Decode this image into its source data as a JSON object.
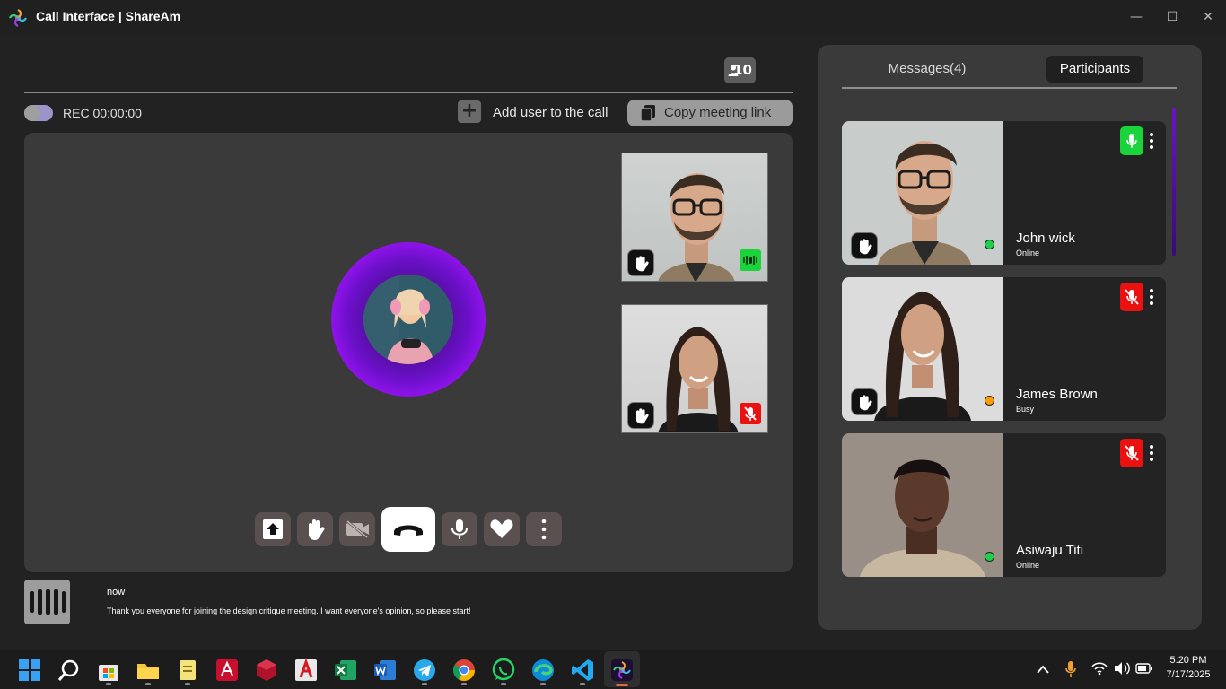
{
  "window": {
    "title": "Call Interface | ShareAm",
    "minimize_glyph": "—",
    "maximize_glyph": "☐",
    "close_glyph": "✕"
  },
  "call": {
    "participant_count": "10",
    "recording_label": "REC 00:00:00",
    "recording_on": false,
    "add_user_glyph": "+",
    "add_user_label": "Add user to the call",
    "copy_link_label": "Copy meeting link"
  },
  "stage": {
    "tiles": [
      {
        "mic": "active",
        "hand": true
      },
      {
        "mic": "muted",
        "hand": true
      }
    ],
    "controls": [
      "share-screen-icon",
      "raise-hand-icon",
      "video-off-icon",
      "end-call-icon",
      "microphone-icon",
      "heart-icon",
      "more-vertical-icon"
    ]
  },
  "notification": {
    "time": "now",
    "message": "Thank you everyone for joining the design critique meeting. I want everyone's opinion, so please start!"
  },
  "panel": {
    "tabs": [
      {
        "label": "Messages(4)",
        "active": false
      },
      {
        "label": "Participants",
        "active": true
      }
    ],
    "participants": [
      {
        "name": "John wick",
        "status": "Online",
        "mic": "on",
        "presence_color": "#21d04a",
        "hand": true
      },
      {
        "name": "James Brown",
        "status": "Busy",
        "mic": "off",
        "presence_color": "#ff9d00",
        "hand": true
      },
      {
        "name": "Asiwaju Titi",
        "status": "Online",
        "mic": "off",
        "presence_color": "#21d04a",
        "hand": false
      }
    ]
  },
  "colors": {
    "accent_purple": "#a514ff",
    "mic_on_green": "#19d43a",
    "mic_off_red": "#ec1111"
  },
  "taskbar": {
    "apps": [
      "windows-start-icon",
      "search-icon",
      "microsoft-store-icon",
      "file-explorer-icon",
      "notepad-icon",
      "autocad-icon",
      "revit-icon",
      "acrobat-icon",
      "excel-icon",
      "word-icon",
      "telegram-icon",
      "chrome-icon",
      "whatsapp-icon",
      "edge-icon",
      "vscode-icon",
      "shaream-icon"
    ],
    "time": "5:20 PM",
    "date": "7/17/2025"
  }
}
